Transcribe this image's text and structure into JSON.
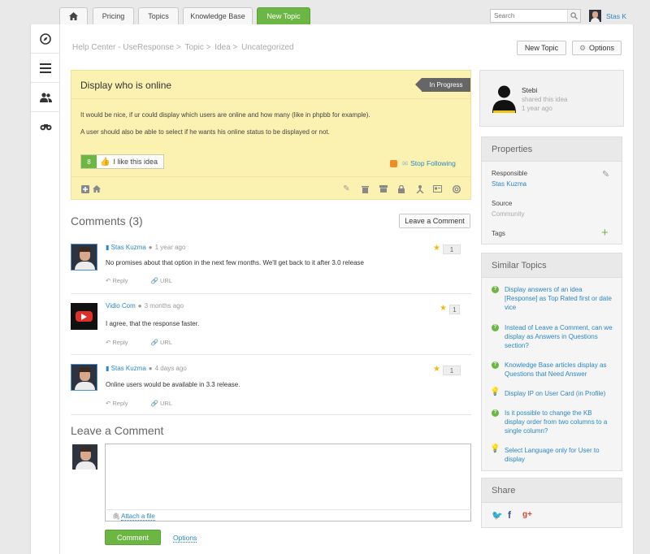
{
  "nav": {
    "tabs": [
      "Pricing",
      "Topics",
      "Knowledge Base"
    ],
    "new_topic": "New Topic",
    "search_placeholder": "Search",
    "user_name": "Stas K"
  },
  "breadcrumb": [
    "Help Center - UseResponse",
    "Topic",
    "Idea",
    "Uncategorized"
  ],
  "toolbar": {
    "new_topic": "New Topic",
    "options": "Options"
  },
  "idea": {
    "title": "Display who is online",
    "status": "In Progress",
    "p1": "It would be nice, if ur could display which users are online and how many (like in phpbb for example).",
    "p2": "A user should also be able to select if he wants his online status to be displayed or not.",
    "like_count": "8",
    "like_label": "I like this idea",
    "stop_following": "Stop Following"
  },
  "comments": {
    "title": "Comments (3)",
    "leave_button": "Leave a Comment",
    "items": [
      {
        "author": "Stas Kuzma",
        "time": "1 year ago",
        "text": "No promises about that option in the next few months. We'll get back to it after 3.0 release",
        "rating": "1"
      },
      {
        "author": "Vidio Com",
        "time": "3 months ago",
        "text": "I agree, that the response faster.",
        "rating": "1"
      },
      {
        "author": "Stas Kuzma",
        "time": "4 days ago",
        "text": "Online users would be available in 3.3 release.",
        "rating": "1"
      }
    ],
    "reply": "Reply",
    "url": "URL"
  },
  "leave": {
    "title": "Leave a Comment",
    "attach": "Attach a file",
    "submit": "Comment",
    "options": "Options"
  },
  "author_card": {
    "name": "Stebi",
    "action": "shared this idea",
    "time": "1 year ago"
  },
  "properties": {
    "title": "Properties",
    "responsible_label": "Responsible",
    "responsible_value": "Stas Kuzma",
    "source_label": "Source",
    "source_value": "Community",
    "tags_label": "Tags"
  },
  "similar": {
    "title": "Similar Topics",
    "items": [
      {
        "text": "Display answers of an idea [Response] as Top Rated first or date vice",
        "icon": "question-icon"
      },
      {
        "text": "Instead of Leave a Comment, can we display as Answers in Questions section?",
        "icon": "question-icon"
      },
      {
        "text": "Knowledge Base articles display as Questions that Need Answer",
        "icon": "question-icon"
      },
      {
        "text": "Display IP on User Card (in Profile)",
        "icon": "bulb-icon"
      },
      {
        "text": "Is it possible to change the KB display order from two columns to a single column?",
        "icon": "question-icon"
      },
      {
        "text": "Select Language only for User to display",
        "icon": "bulb-icon"
      }
    ]
  },
  "share": {
    "title": "Share"
  },
  "colors": {
    "green": "#6cb744",
    "link": "#2b88c8",
    "idea_bg": "#fbf1b0"
  }
}
